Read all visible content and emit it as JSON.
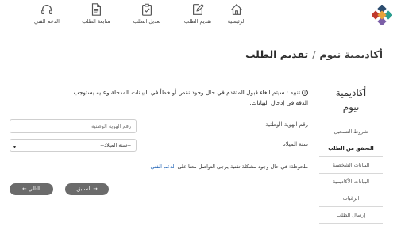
{
  "nav": {
    "items": [
      {
        "label": "الرئيسية",
        "icon": "home-icon"
      },
      {
        "label": "تقديم الطلب",
        "icon": "edit-icon"
      },
      {
        "label": "تعديل الطلب",
        "icon": "clipboard-check-icon"
      },
      {
        "label": "متابعة الطلب",
        "icon": "document-icon"
      },
      {
        "label": "الدعم الفني",
        "icon": "headset-icon"
      }
    ]
  },
  "header": {
    "brand": "أكاديمية نيوم",
    "separator": "/",
    "page": "تقديم الطلب"
  },
  "sidebar": {
    "brand_line1": "أكاديمية",
    "brand_line2": "نيوم",
    "items": [
      {
        "label": "شروط التسجيل"
      },
      {
        "label": "التحقق من الطلب"
      },
      {
        "label": "البيانات الشخصية"
      },
      {
        "label": "البيانات الأكاديمية"
      },
      {
        "label": "الرغبات"
      },
      {
        "label": "إرسال الطلب"
      }
    ]
  },
  "main": {
    "notice_line1": "تنبيه : سيتم الغاء قبول المتقدم في حال وجود نقص أو خطأ في البيانات المدخلة وعليه يستوجب",
    "notice_line2": "الدقة في إدخال البيانات.",
    "id_label": "رقم الهوية الوطنية",
    "id_placeholder": "رقم الهوية الوطنية",
    "birth_label": "سنة الميلاد",
    "birth_selected": "--سنة الميلاد--",
    "note_text": "ملحوظة: في حال وجود مشكلة تقنية يرجى التواصل معنا على",
    "note_link": "الدعم الفني",
    "prev_label": "→ السابق",
    "next_label": "التالي ←"
  }
}
